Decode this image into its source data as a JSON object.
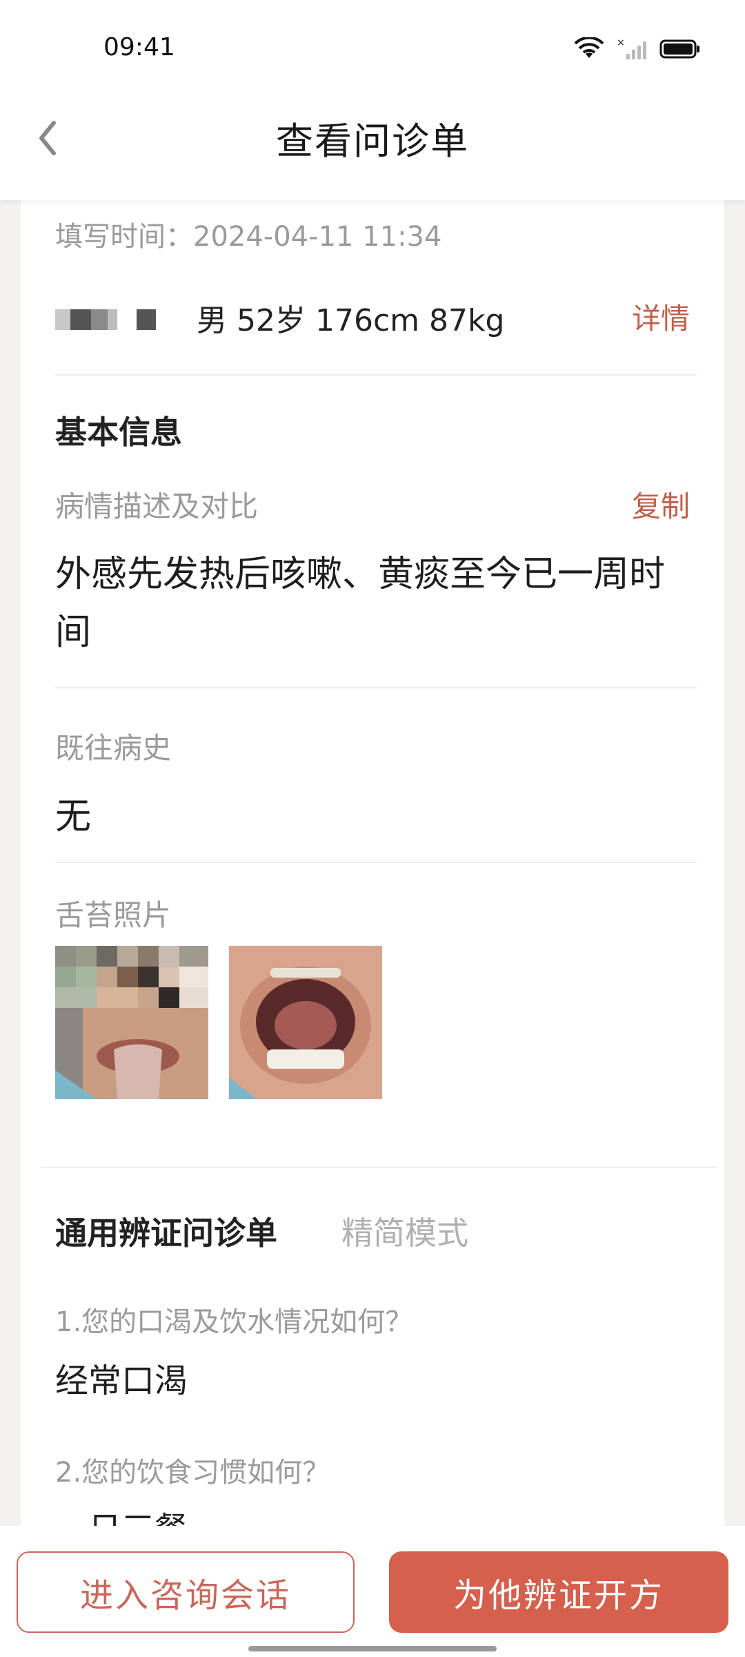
{
  "status_bar": {
    "time": "09:41",
    "icons": [
      "wifi-icon",
      "signal-icon",
      "battery-icon"
    ]
  },
  "nav": {
    "title": "查看问诊单",
    "back_icon": "back-arrow-icon"
  },
  "record": {
    "fill_time": "填写时间：2024-04-11 11:34",
    "patient_info": "男 52岁 176cm 87kg",
    "detail_label": "详情"
  },
  "basic_info": {
    "section_title": "基本信息",
    "description_label": "病情描述及对比",
    "copy_label": "复制",
    "description": "外感先发热后咳嗽、黄痰至今已一周时间",
    "history_label": "既往病史",
    "history": "无",
    "tongue_photos_label": "舌苔照片",
    "photo_count": 2
  },
  "questionnaire": {
    "title": "通用辨证问诊单",
    "mode_label": "精简模式",
    "items": [
      {
        "question": "1.您的口渴及饮水情况如何？",
        "answer": "经常口渴"
      },
      {
        "question": "2.您的饮食习惯如何？",
        "answer": "一日三餐"
      }
    ]
  },
  "actions": {
    "chat_button": "进入咨询会话",
    "prescribe_button": "为他辨证开方"
  },
  "colors": {
    "accent": "#d4604d",
    "link": "#c0604a",
    "muted_text": "#9a9a9a"
  }
}
